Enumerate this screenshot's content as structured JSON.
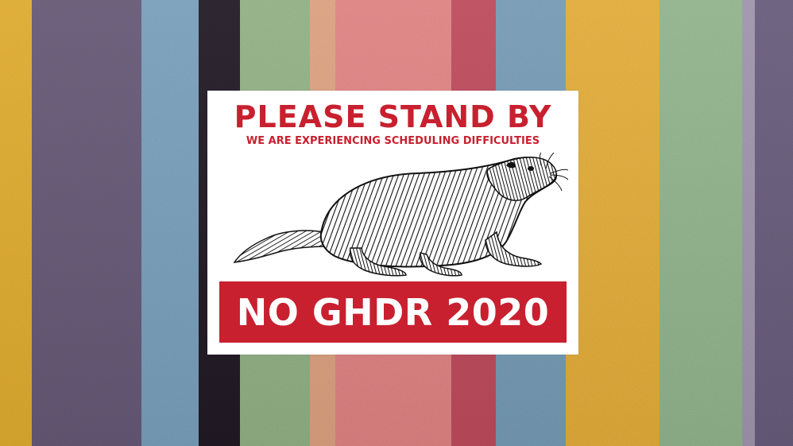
{
  "background": {
    "stripe_colors": [
      "#e9b332",
      "#6a5c7b",
      "#7ea6c3",
      "#231a25",
      "#98b88a",
      "#e5a886",
      "#e98989",
      "#c54e60",
      "#7aa2bd",
      "#ecb43c",
      "#98bb92",
      "#6c6080"
    ]
  },
  "sign": {
    "headline": "PLEASE STAND BY",
    "subhead": "WE ARE EXPERIENCING SCHEDULING DIFFICULTIES",
    "illustration_icon": "groundhog-illustration",
    "banner_text": "NO GHDR 2020",
    "accent_color": "#c8202f",
    "card_color": "#ffffff"
  }
}
